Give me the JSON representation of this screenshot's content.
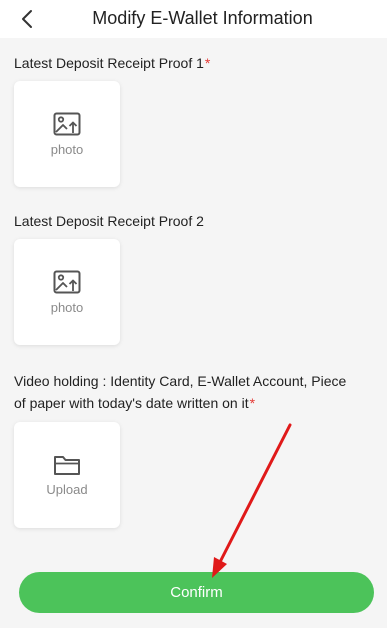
{
  "header": {
    "title": "Modify E-Wallet Information"
  },
  "sections": [
    {
      "label": "Latest Deposit Receipt Proof 1",
      "required": "*",
      "caption": "photo",
      "icon": "image-upload-icon"
    },
    {
      "label": "Latest Deposit Receipt Proof 2",
      "required": "",
      "caption": "photo",
      "icon": "image-upload-icon"
    },
    {
      "label_line1": "Video holding : Identity Card, E-Wallet Account, Piece",
      "label_line2": "of paper with today's date written on it",
      "required": "*",
      "caption": "Upload",
      "icon": "folder-icon"
    }
  ],
  "confirm_label": "Confirm",
  "colors": {
    "accent": "#4cc35a",
    "required": "#e53935",
    "annotation_arrow": "#e01919"
  }
}
